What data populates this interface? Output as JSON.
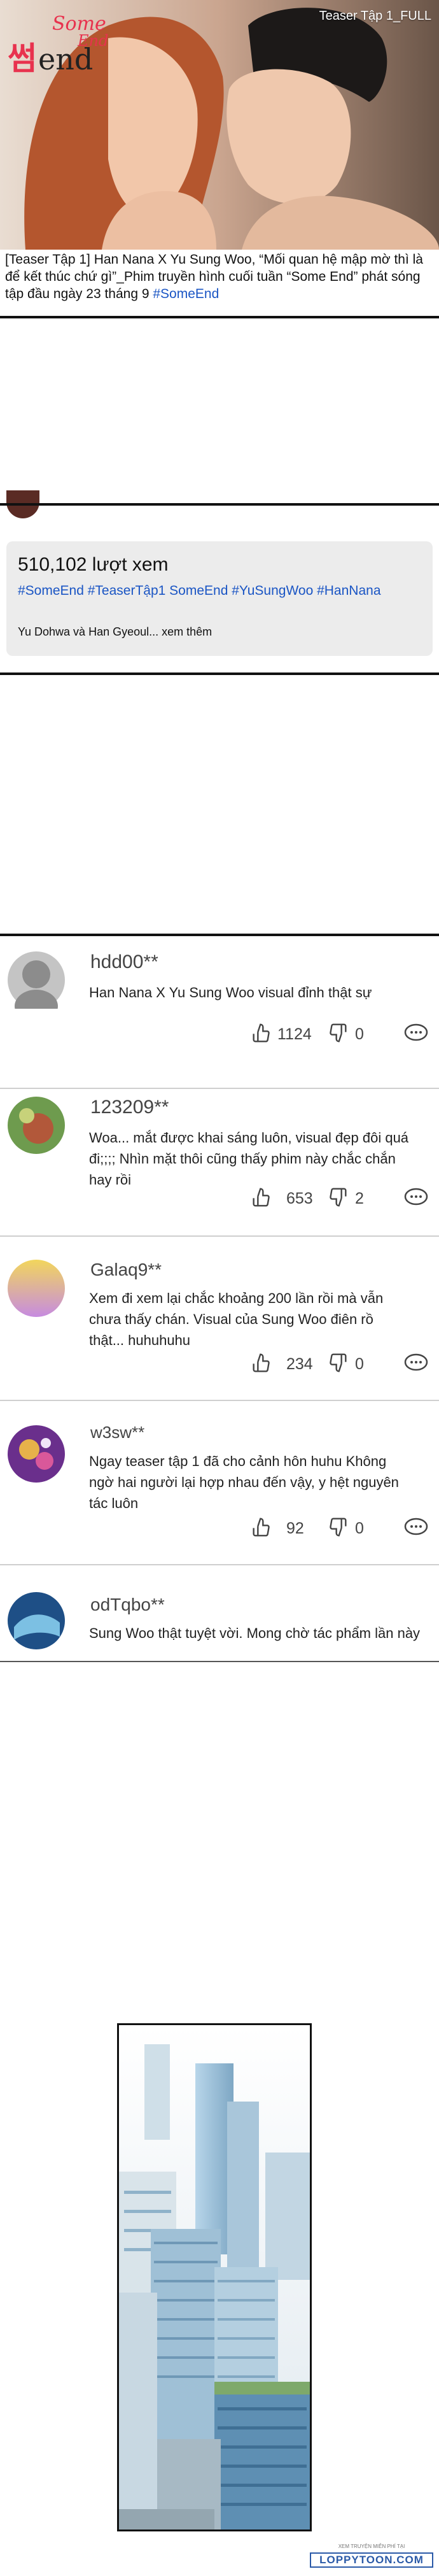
{
  "video": {
    "title": "Teaser Tập 1_FULL",
    "logo_korean": "썸",
    "logo_english": "end",
    "logo_script": "Some",
    "logo_script_end": "End"
  },
  "caption": {
    "text": "[Teaser Tập 1] Han Nana X Yu Sung Woo, “Mối quan hệ mập mờ thì là để kết thúc chứ gì”_Phim truyền hình cuối tuần “Some End” phát sóng tập đầu ngày 23 tháng 9 ",
    "hashtag": "#SomeEnd"
  },
  "info": {
    "views": "510,102 lượt xem",
    "tags": "#SomeEnd #TeaserTập1 SomeEnd #YuSungWoo #HanNana",
    "description": "Yu Dohwa và Han Gyeoul... xem thêm"
  },
  "comments": [
    {
      "user": "hdd00**",
      "text": "Han Nana X Yu Sung Woo visual đỉnh thật sự",
      "likes": "1124",
      "dislikes": "0",
      "avatar_color": "#bdbdbd"
    },
    {
      "user": "123209**",
      "text": "Woa... mắt được khai sáng luôn, visual đẹp đôi quá đi;;;; Nhìn mặt thôi cũng thấy phim này chắc chắn hay rồi",
      "likes": "653",
      "dislikes": "2",
      "avatar_color": "#7aa35a"
    },
    {
      "user": "Galaq9**",
      "text": "Xem đi xem lại chắc khoảng 200 lần rồi mà vẫn chưa thấy chán. Visual của Sung Woo điên rồ thật... huhuhuhu",
      "likes": "234",
      "dislikes": "0",
      "avatar_color": "#e6cf6a"
    },
    {
      "user": "w3sw**",
      "text": "Ngay teaser tập 1 đã cho cảnh hôn huhu Không ngờ hai người lại hợp nhau đến vậy, y hệt nguyên tác luôn",
      "likes": "92",
      "dislikes": "0",
      "avatar_color": "#8a3fae"
    },
    {
      "user": "odTqbo**",
      "text": "Sung Woo thật tuyệt vời. Mong chờ tác phẩm lần này",
      "avatar_color": "#2f6aa3"
    }
  ],
  "watermark": {
    "top": "XEM TRUYỆN MIỄN PHÍ TẠI",
    "main": "LOPPYTOON.COM"
  }
}
